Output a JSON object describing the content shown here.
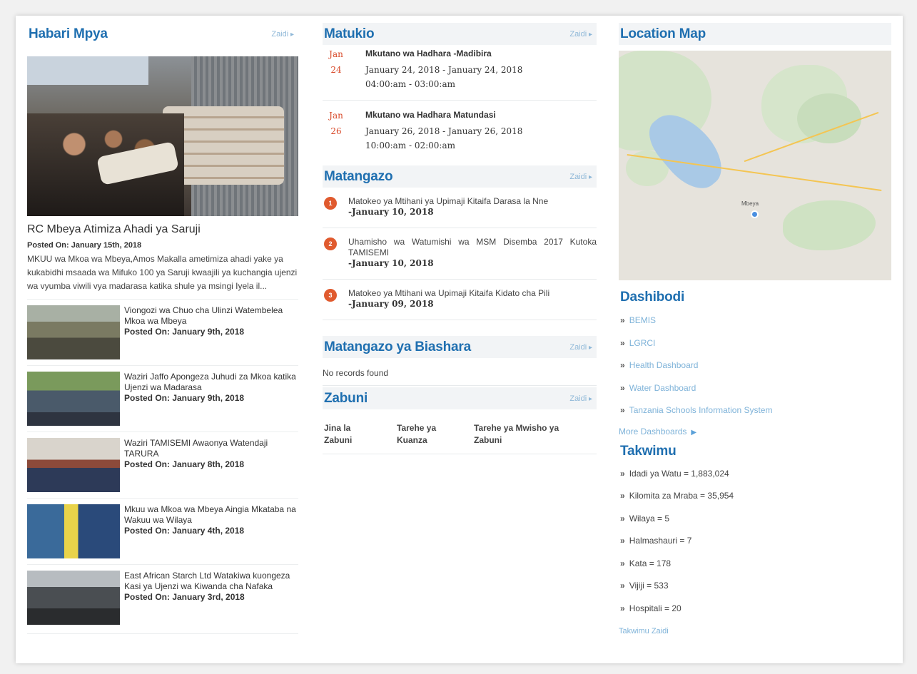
{
  "habari": {
    "title": "Habari Mpya",
    "more": "Zaidi",
    "featured": {
      "title": "RC Mbeya Atimiza Ahadi ya Saruji",
      "date": "Posted On: January 15th, 2018",
      "desc": "MKUU wa Mkoa wa Mbeya,Amos Makalla ametimiza ahadi yake ya kukabidhi msaada wa Mifuko 100 ya Saruji kwaajili ya kuchangia ujenzi wa vyumba viwili vya madarasa katika shule ya msingi Iyela il..."
    },
    "items": [
      {
        "title": "Viongozi wa Chuo cha Ulinzi Watembelea Mkoa wa Mbeya",
        "date": "Posted On: January 9th, 2018"
      },
      {
        "title": "Waziri Jaffo Apongeza Juhudi za Mkoa katika Ujenzi wa Madarasa",
        "date": "Posted On: January 9th, 2018"
      },
      {
        "title": "Waziri TAMISEMI Awaonya Watendaji TARURA",
        "date": "Posted On: January 8th, 2018"
      },
      {
        "title": "Mkuu wa Mkoa wa Mbeya Aingia Mkataba na Wakuu wa Wilaya",
        "date": "Posted On: January 4th, 2018"
      },
      {
        "title": "East African Starch Ltd Watakiwa kuongeza Kasi ya Ujenzi wa Kiwanda cha Nafaka",
        "date": "Posted On: January 3rd, 2018"
      }
    ]
  },
  "matukio": {
    "title": "Matukio",
    "more": "Zaidi",
    "events": [
      {
        "month": "Jan",
        "day": "24",
        "title": "Mkutano wa Hadhara -Madibira",
        "range": "January 24, 2018 - January 24, 2018",
        "time": "04:00:am - 03:00:am"
      },
      {
        "month": "Jan",
        "day": "26",
        "title": "Mkutano wa Hadhara Matundasi",
        "range": "January 26, 2018 - January 26, 2018",
        "time": "10:00:am - 02:00:am"
      }
    ]
  },
  "matangazo": {
    "title": "Matangazo",
    "more": "Zaidi",
    "items": [
      {
        "num": "1",
        "text": "Matokeo ya Mtihani ya Upimaji Kitaifa Darasa la Nne",
        "date": "-January 10, 2018"
      },
      {
        "num": "2",
        "text": "Uhamisho wa Watumishi wa MSM Disemba 2017 Kutoka TAMISEMI",
        "date": "-January 10, 2018"
      },
      {
        "num": "3",
        "text": "Matokeo ya Mtihani wa Upimaji Kitaifa Kidato cha Pili",
        "date": "-January 09, 2018"
      }
    ]
  },
  "biashara": {
    "title": "Matangazo ya Biashara",
    "more": "Zaidi",
    "empty": "No records found"
  },
  "zabuni": {
    "title": "Zabuni",
    "more": "Zaidi",
    "columns": [
      "Jina la Zabuni",
      "Tarehe ya Kuanza",
      "Tarehe ya Mwisho ya Zabuni"
    ]
  },
  "map": {
    "title": "Location Map",
    "place_label": "Mbeya"
  },
  "dashibodi": {
    "title": "Dashibodi",
    "links": [
      "BEMIS",
      "LGRCI",
      "Health Dashboard",
      "Water Dashboard",
      "Tanzania Schools Information System"
    ],
    "more": "More Dashboards"
  },
  "takwimu": {
    "title": "Takwimu",
    "stats": [
      "Idadi ya Watu = 1,883,024",
      "Kilomita za Mraba = 35,954",
      "Wilaya = 5",
      "Halmashauri = 7",
      "Kata = 178",
      "Vijiji = 533",
      "Hospitali = 20"
    ],
    "more": "Takwimu Zaidi"
  },
  "colors": {
    "heading": "#1f6fb0",
    "link": "#7fb3d9",
    "accent": "#e05a2e",
    "event_date": "#d84a2a"
  }
}
